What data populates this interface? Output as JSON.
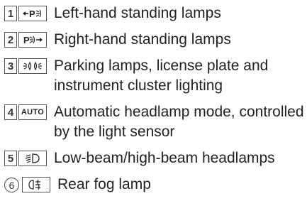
{
  "items": [
    {
      "number": "1",
      "number_style": "box",
      "symbol_icon": "left-standing-lamp-icon",
      "description": "Left-hand standing lamps"
    },
    {
      "number": "2",
      "number_style": "box",
      "symbol_icon": "right-standing-lamp-icon",
      "description": "Right-hand standing lamps"
    },
    {
      "number": "3",
      "number_style": "box",
      "symbol_icon": "parking-lamps-icon",
      "description": "Parking lamps, license plate and instrument cluster lighting"
    },
    {
      "number": "4",
      "number_style": "box",
      "symbol_icon": "auto-headlamp-icon",
      "symbol_text": "AUTO",
      "description": "Automatic headlamp mode, controlled by the light sensor"
    },
    {
      "number": "5",
      "number_style": "box",
      "symbol_icon": "low-beam-headlamp-icon",
      "description": "Low-beam/high-beam headlamps"
    },
    {
      "number": "6",
      "number_style": "circle",
      "symbol_icon": "rear-fog-lamp-icon",
      "description": "Rear fog lamp"
    }
  ]
}
